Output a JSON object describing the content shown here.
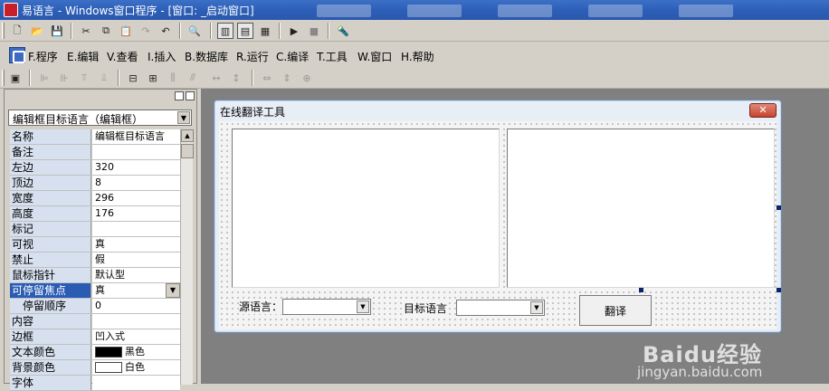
{
  "window": {
    "title": "易语言 - Windows窗口程序 - [窗口: _启动窗口]"
  },
  "menu": {
    "items": [
      {
        "label": "F.程序"
      },
      {
        "label": "E.编辑"
      },
      {
        "label": "V.查看"
      },
      {
        "label": "I.插入"
      },
      {
        "label": "B.数据库"
      },
      {
        "label": "R.运行"
      },
      {
        "label": "C.编译"
      },
      {
        "label": "T.工具"
      },
      {
        "label": "W.窗口"
      },
      {
        "label": "H.帮助"
      }
    ]
  },
  "properties": {
    "selector": "编辑框目标语言（编辑框）",
    "rows": [
      {
        "name": "名称",
        "value": "编辑框目标语言"
      },
      {
        "name": "备注",
        "value": ""
      },
      {
        "name": "左边",
        "value": "320"
      },
      {
        "name": "顶边",
        "value": "8"
      },
      {
        "name": "宽度",
        "value": "296"
      },
      {
        "name": "高度",
        "value": "176"
      },
      {
        "name": "标记",
        "value": ""
      },
      {
        "name": "可视",
        "value": "真"
      },
      {
        "name": "禁止",
        "value": "假"
      },
      {
        "name": "鼠标指针",
        "value": "默认型"
      },
      {
        "name": "可停留焦点",
        "value": "真"
      },
      {
        "name": "停留顺序",
        "value": "0"
      },
      {
        "name": "内容",
        "value": ""
      },
      {
        "name": "边框",
        "value": "凹入式"
      },
      {
        "name": "文本颜色",
        "value": "黑色"
      },
      {
        "name": "背景颜色",
        "value": "白色"
      },
      {
        "name": "字体",
        "value": ""
      }
    ]
  },
  "form": {
    "title": "在线翻译工具",
    "close_label": "✕",
    "source_label": "源语言：",
    "target_label": "目标语言",
    "translate_button": "翻译"
  },
  "watermark": {
    "line1": "Baidu经验",
    "line2": "jingyan.baidu.com"
  },
  "colors": {
    "title_bar": "#2d5fb8",
    "selected_row": "#2a5cb4",
    "workspace": "#808080",
    "text_color_swatch": "#000000",
    "background_color_swatch": "#ffffff"
  }
}
